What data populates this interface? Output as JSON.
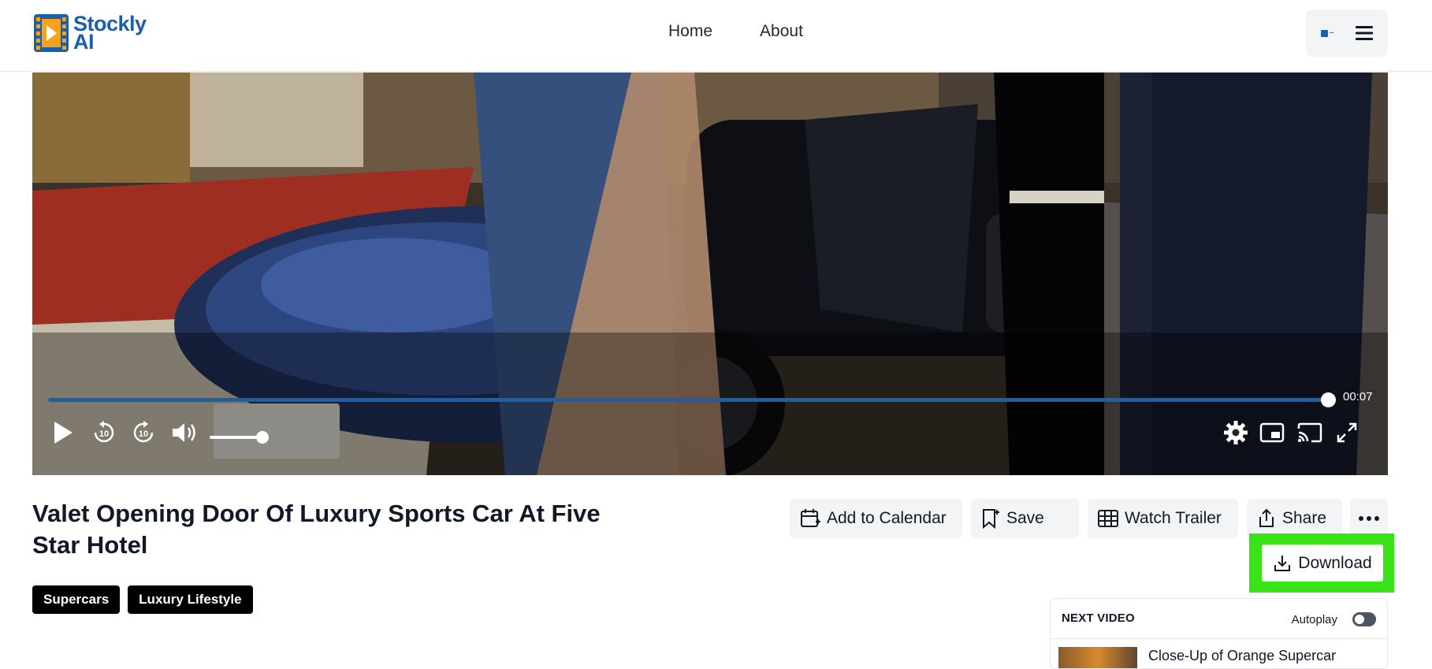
{
  "header": {
    "logo_line1": "Stockly",
    "logo_line2": "AI",
    "nav": [
      {
        "label": "Home"
      },
      {
        "label": "About"
      }
    ]
  },
  "player": {
    "progress_fraction": 0.99,
    "time": "00:07",
    "volume_fraction": 0.9
  },
  "video": {
    "title": "Valet Opening Door Of Luxury Sports Car At Five Star Hotel",
    "tags": [
      "Supercars",
      "Luxury Lifestyle"
    ]
  },
  "actions": {
    "add_to_calendar": "Add to Calendar",
    "save": "Save",
    "watch_trailer": "Watch Trailer",
    "share": "Share",
    "download": "Download"
  },
  "next_video": {
    "heading": "NEXT VIDEO",
    "autoplay_label": "Autoplay",
    "autoplay_on": false,
    "title": "Close-Up of Orange Supercar"
  },
  "colors": {
    "brand": "#1a5fa8",
    "highlight": "#39e317"
  }
}
